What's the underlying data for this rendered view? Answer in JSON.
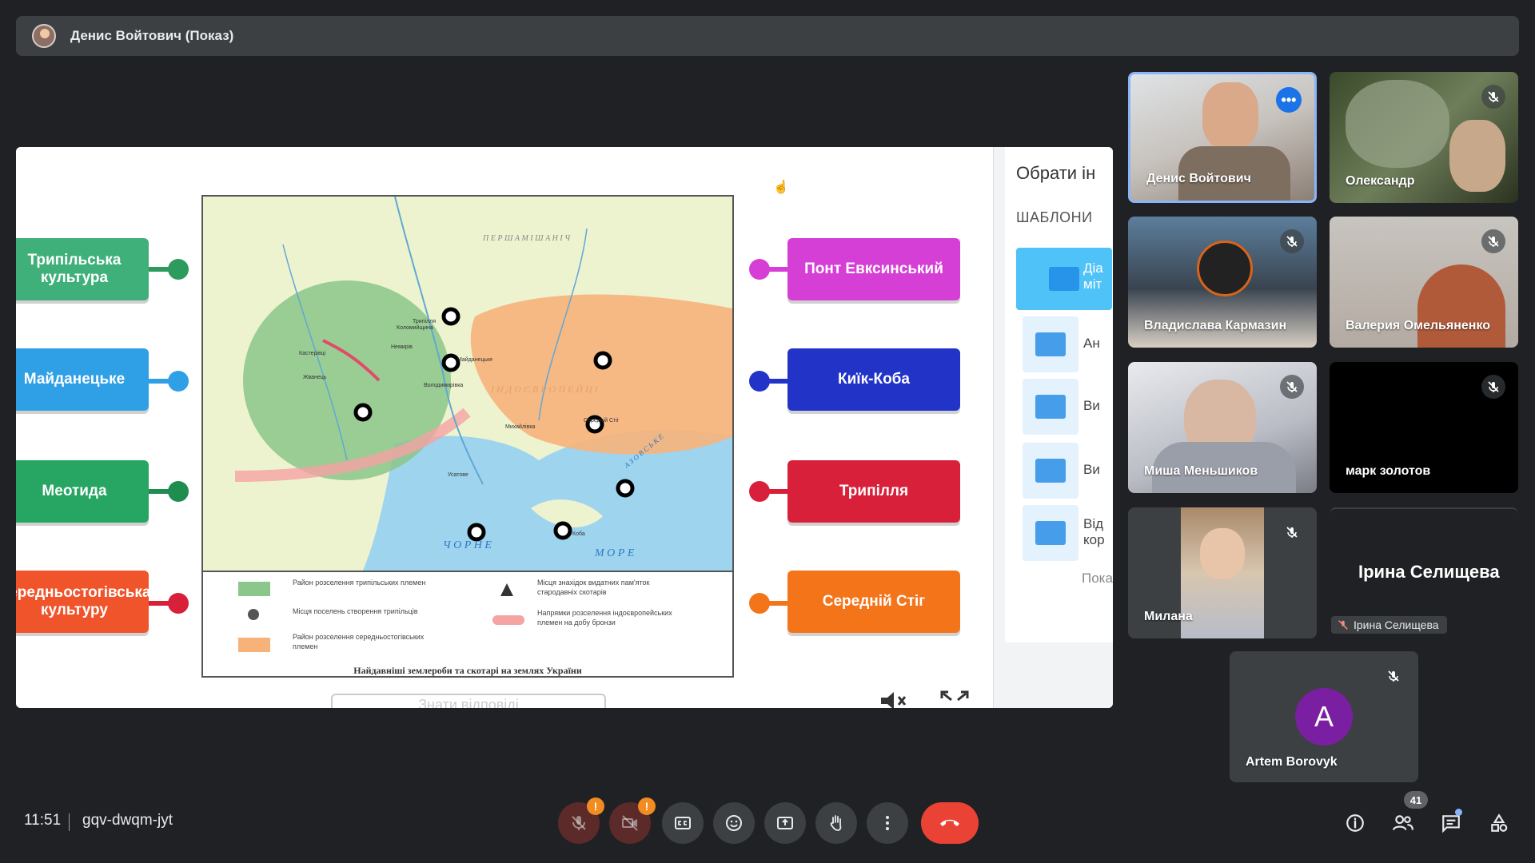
{
  "presenter_bar": {
    "title": "Денис Войтович (Показ)"
  },
  "slide": {
    "left_labels": [
      {
        "text": "Трипільська культура",
        "color": "#3fb07a"
      },
      {
        "text": "Майданецьке",
        "color": "#2fa0e6"
      },
      {
        "text": "Меотида",
        "color": "#27a562"
      },
      {
        "text": "Середньостогівська культуру",
        "color": "#f0542a"
      }
    ],
    "right_labels": [
      {
        "text": "Понт Евксинський",
        "color": "#d63fd6"
      },
      {
        "text": "Киїк-Коба",
        "color": "#2234c8"
      },
      {
        "text": "Трипілля",
        "color": "#d8203a"
      },
      {
        "text": "Середній Стіг",
        "color": "#f4741a"
      }
    ],
    "map": {
      "labels": {
        "top": "П Е Р Ш А   М І Ш А Н І Ч",
        "middle": "І Н Д О Є В Р О П Е Й Ц І",
        "sea1": "Ч О Р Н Е",
        "sea2": "М О Р Е",
        "azov": "А З О В С Ь К Е",
        "towns": [
          "Трипілля",
          "Коломийщина",
          "Кастерівці",
          "Немирів",
          "Жванець",
          "Майданецьке",
          "Володимирівка",
          "Михайлівка",
          "Середній Стіг",
          "Усатове",
          "Коба"
        ]
      },
      "legend": [
        "Район розселення трипільських племен",
        "Місця поселень створення трипільців",
        "Район розселення середньостогівських племен",
        "Місця знахідок видатних пам'яток стародавніх скотарів",
        "Напрямки розселення індоєвропейських племен на добу бронзи"
      ],
      "caption": "Найдавніші землероби та скотарі на землях України"
    },
    "answer_button": "Знати відповіді"
  },
  "side_panel": {
    "title": "Обрати ін",
    "subtitle": "ШАБЛОНИ",
    "items": [
      "Діа міт",
      "Ан",
      "Ви",
      "Ви",
      "Від кор"
    ],
    "more": "Пока"
  },
  "participants": [
    {
      "name": "Денис Войтович",
      "muted": false,
      "speaking": true
    },
    {
      "name": "Олександр",
      "muted": true
    },
    {
      "name": "Владислава Кармазин",
      "muted": true
    },
    {
      "name": "Валерия Омельяненко",
      "muted": true
    },
    {
      "name": "Миша Меньшиков",
      "muted": true
    },
    {
      "name": "марк золотов",
      "muted": true
    },
    {
      "name": "Милана",
      "muted": true
    },
    {
      "name": "Ірина Селищева",
      "subname": "Ірина Селищева",
      "muted": true
    },
    {
      "name": "Artem Borovyk",
      "initial": "A",
      "muted": true
    }
  ],
  "bottom_bar": {
    "time": "11:51",
    "meeting_code": "gqv-dwqm-jyt",
    "participant_count": "41",
    "warning_mark": "!"
  }
}
